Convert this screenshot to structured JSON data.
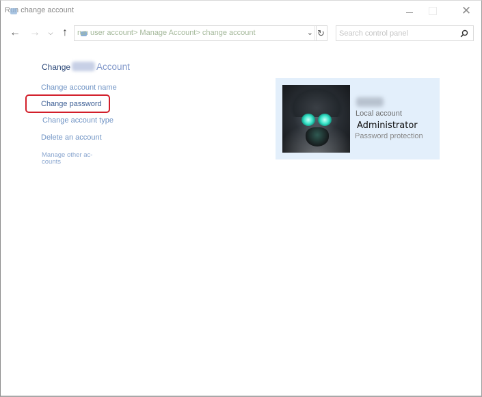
{
  "window": {
    "title": "Run change account",
    "controls": {
      "minimize": "minimize",
      "maximize": "maximize",
      "close": "✕"
    }
  },
  "nav": {
    "back_icon": "←",
    "forward_icon": "→",
    "recent_icon": "⌄",
    "up_icon": "↑",
    "address": "run user account> Manage Account> change account",
    "address_dropdown_icon": "⌄",
    "refresh_icon": "↻",
    "search_placeholder": "Search control panel",
    "search_value": ""
  },
  "task_pane": {
    "heading_prefix": "Change",
    "heading_suffix": "Account",
    "links": [
      {
        "label": "Change account name",
        "highlighted": false
      },
      {
        "label": "Change password",
        "highlighted": true
      },
      {
        "label": "Change account type",
        "highlighted": false
      },
      {
        "label": "Delete an account",
        "highlighted": false
      },
      {
        "label": "Manage other ac-",
        "label_line2": "counts",
        "highlighted": false
      }
    ]
  },
  "account": {
    "type": "Local account",
    "role": "Administrator",
    "password_status": "Password protection"
  },
  "colors": {
    "highlight_border": "#d21e2a",
    "card_background": "#e3effb",
    "link": "#6f93c4"
  }
}
